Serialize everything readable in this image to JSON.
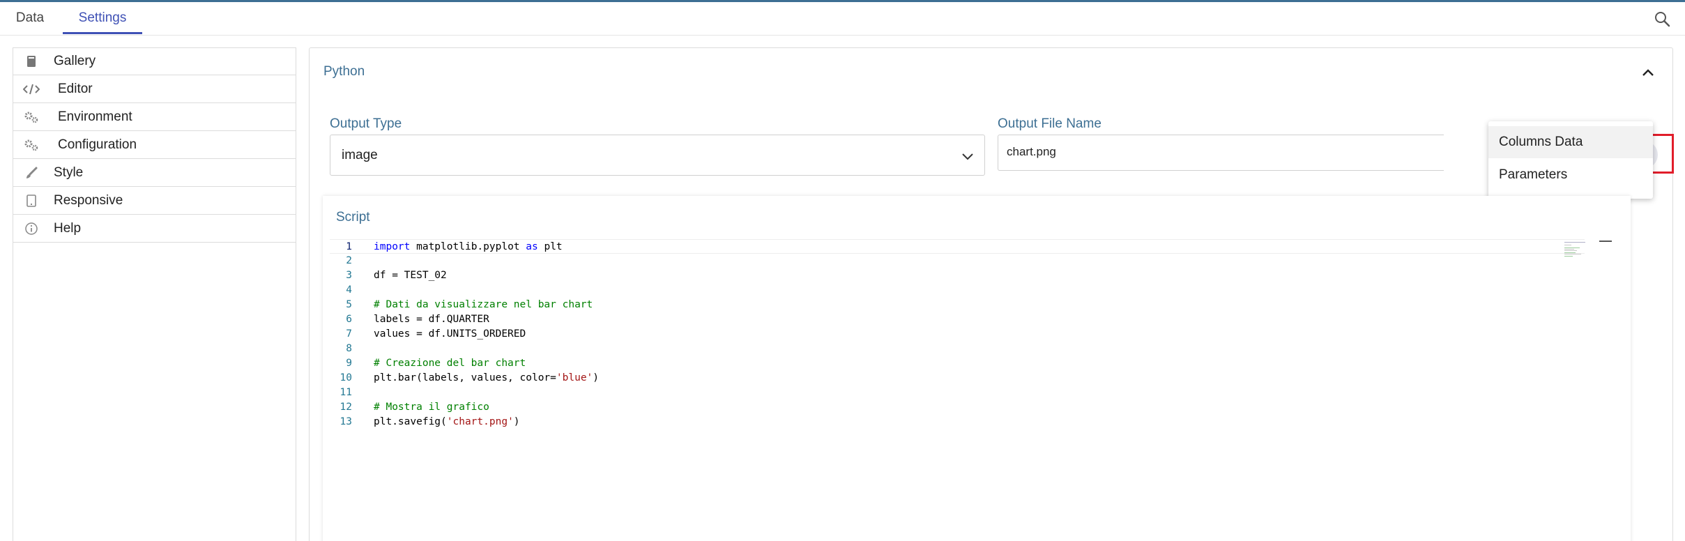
{
  "tabs": [
    {
      "label": "Data",
      "active": false
    },
    {
      "label": "Settings",
      "active": true
    }
  ],
  "header": {
    "search_icon": "search-icon"
  },
  "sidebar": {
    "items": [
      {
        "label": "Gallery",
        "icon": "book-icon"
      },
      {
        "label": "Editor",
        "icon": "code-icon"
      },
      {
        "label": "Environment",
        "icon": "gears-icon"
      },
      {
        "label": "Configuration",
        "icon": "gears-icon"
      },
      {
        "label": "Style",
        "icon": "brush-icon"
      },
      {
        "label": "Responsive",
        "icon": "device-icon"
      },
      {
        "label": "Help",
        "icon": "info-icon"
      }
    ]
  },
  "panel": {
    "title": "Python",
    "output_type": {
      "label": "Output Type",
      "value": "image"
    },
    "output_file": {
      "label": "Output File Name",
      "value": "chart.png"
    },
    "menu": {
      "items": [
        "Columns Data",
        "Parameters"
      ]
    },
    "script": {
      "title": "Script",
      "lines": [
        "import matplotlib.pyplot as plt",
        "",
        "df = TEST_02",
        "",
        "# Dati da visualizzare nel bar chart",
        "labels = df.QUARTER",
        "values = df.UNITS_ORDERED",
        "",
        "# Creazione del bar chart",
        "plt.bar(labels, values, color='blue')",
        "",
        "# Mostra il grafico",
        "plt.savefig('chart.png')"
      ],
      "line_numbers": [
        "1",
        "2",
        "3",
        "4",
        "5",
        "6",
        "7",
        "8",
        "9",
        "10",
        "11",
        "12",
        "13"
      ]
    }
  },
  "colors": {
    "accent": "#3f51b5",
    "label": "#3d6f93",
    "highlight_border": "#e11d2a"
  }
}
